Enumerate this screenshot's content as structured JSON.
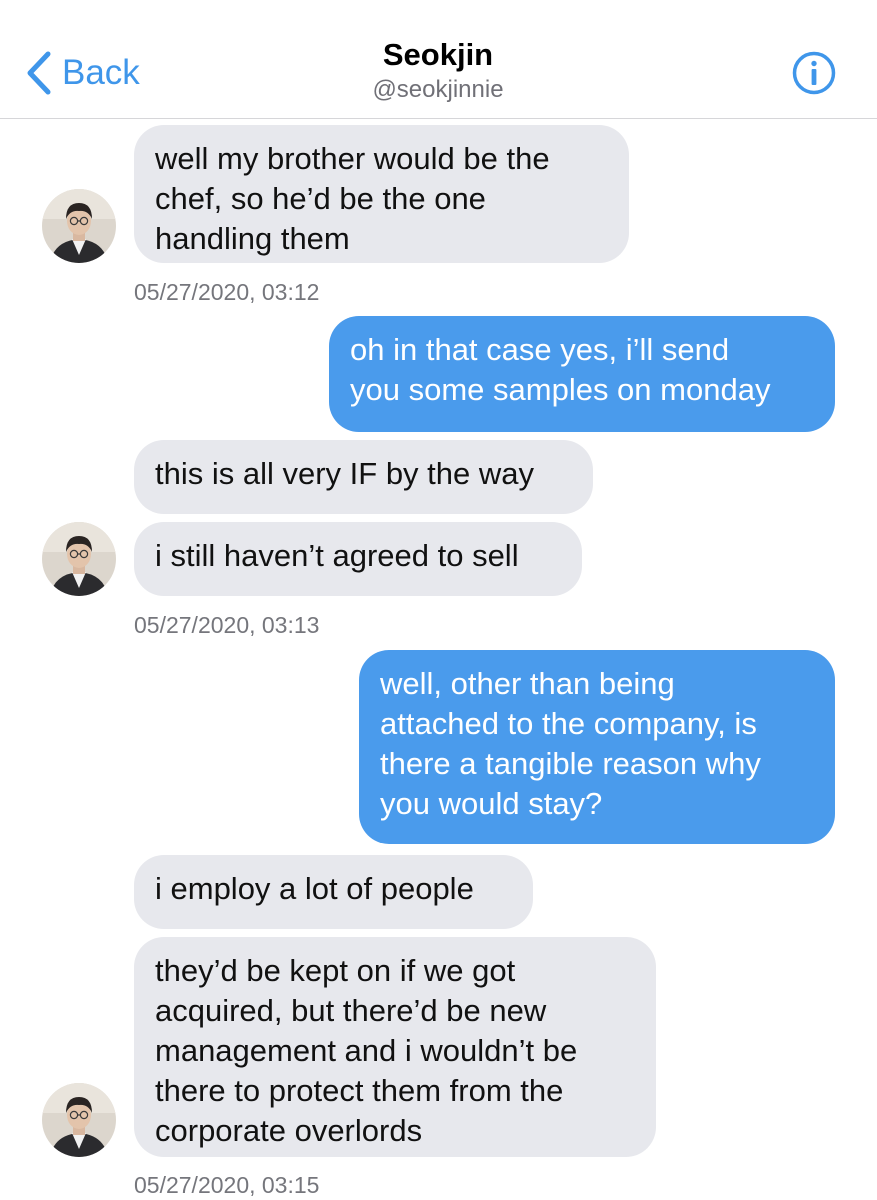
{
  "header": {
    "back_label": "Back",
    "name": "Seokjin",
    "handle": "@seokjinnie"
  },
  "icons": {
    "back": "chevron-left-icon",
    "info": "info-circle-icon",
    "avatar": "profile-photo"
  },
  "colors": {
    "accent": "#3f96ea",
    "incoming_bubble": "#e7e8ed",
    "outgoing_bubble": "#4a9bec",
    "timestamp": "#75767c"
  },
  "messages": [
    {
      "sender": "contact",
      "text": "well my brother would be the\nchef, so he’d be the one\nhandling them"
    },
    {
      "sender": "me",
      "text": "oh in that case yes, i’ll send\nyou some samples on monday"
    },
    {
      "sender": "contact",
      "text": "this is all very IF by the way"
    },
    {
      "sender": "contact",
      "text": "i still haven’t agreed to sell"
    },
    {
      "sender": "me",
      "text": "well, other than being\nattached to the company, is\nthere a tangible reason why\nyou would stay?"
    },
    {
      "sender": "contact",
      "text": "i employ a lot of people"
    },
    {
      "sender": "contact",
      "text": "they’d be kept on if we got\nacquired, but there’d be new\nmanagement and i wouldn’t be\nthere to protect them from the\ncorporate overlords"
    }
  ],
  "timestamps": [
    "05/27/2020, 03:12",
    "05/27/2020, 03:13",
    "05/27/2020, 03:15"
  ]
}
